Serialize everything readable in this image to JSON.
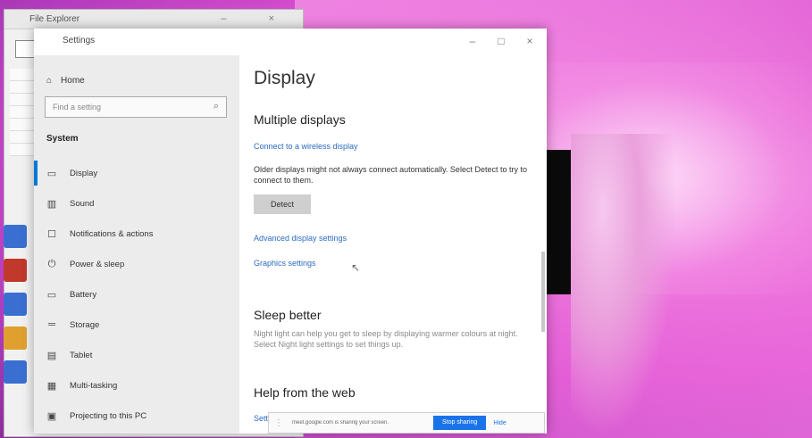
{
  "background_window": {
    "title": "File Explorer"
  },
  "settings": {
    "app_name": "Settings",
    "window_controls": {
      "minimize": "–",
      "maximize": "□",
      "close": "×"
    },
    "nav": {
      "home_label": "Home",
      "search_placeholder": "Find a setting",
      "section_label": "System",
      "items": [
        {
          "label": "Display",
          "icon": "monitor-icon"
        },
        {
          "label": "Sound",
          "icon": "speaker-icon"
        },
        {
          "label": "Notifications & actions",
          "icon": "notification-icon"
        },
        {
          "label": "Power & sleep",
          "icon": "power-icon"
        },
        {
          "label": "Battery",
          "icon": "battery-icon"
        },
        {
          "label": "Storage",
          "icon": "storage-icon"
        },
        {
          "label": "Tablet",
          "icon": "tablet-icon"
        },
        {
          "label": "Multi-tasking",
          "icon": "multitasking-icon"
        },
        {
          "label": "Projecting to this PC",
          "icon": "projector-icon"
        }
      ]
    },
    "content": {
      "title": "Display",
      "multiple_displays_heading": "Multiple displays",
      "connect_link": "Connect to a wireless display",
      "detect_text": "Older displays might not always connect automatically. Select Detect to try to connect to them.",
      "detect_button": "Detect",
      "advanced_link": "Advanced display settings",
      "graphics_link": "Graphics settings",
      "sleep_heading": "Sleep better",
      "sleep_text": "Night light can help you get to sleep by displaying warmer colours at night. Select Night light settings to set things up.",
      "help_heading": "Help from the web",
      "help_link": "Setting"
    }
  },
  "share_banner": {
    "text": "meet.google.com is sharing your screen.",
    "stop_label": "Stop sharing",
    "hide_label": "Hide"
  }
}
